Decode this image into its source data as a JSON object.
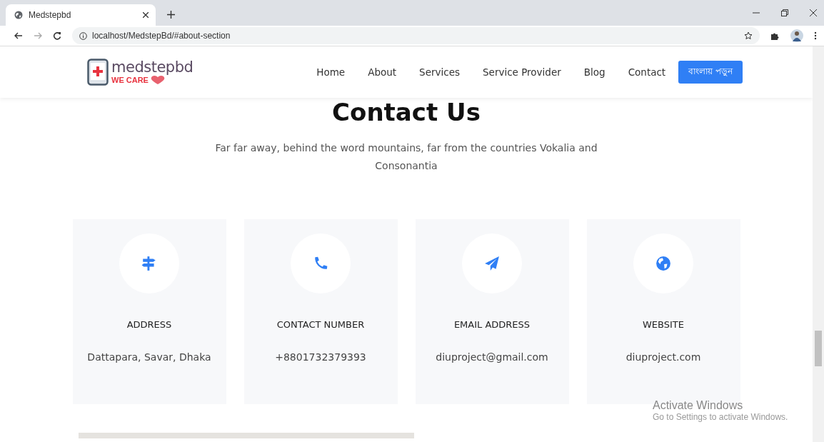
{
  "browser": {
    "tab_title": "Medstepbd",
    "url": "localhost/MedstepBd/#about-section"
  },
  "logo": {
    "name": "medstepbd",
    "tagline": "WE CARE"
  },
  "nav": {
    "links": [
      "Home",
      "About",
      "Services",
      "Service Provider",
      "Blog",
      "Contact"
    ],
    "button": "বাংলায় পড়ুন"
  },
  "section": {
    "title": "Contact Us",
    "subtitle": "Far far away, behind the word mountains, far from the countries Vokalia and Consonantia"
  },
  "cards": [
    {
      "kind": "address",
      "title": "ADDRESS",
      "value": "Dattapara, Savar, Dhaka"
    },
    {
      "kind": "phone",
      "title": "CONTACT NUMBER",
      "value": "+8801732379393"
    },
    {
      "kind": "email",
      "title": "EMAIL ADDRESS",
      "value": "diuproject@gmail.com"
    },
    {
      "kind": "website",
      "title": "WEBSITE",
      "value": "diuproject.com"
    }
  ],
  "os_notice": {
    "title": "Activate Windows",
    "hint": "Go to Settings to activate Windows."
  }
}
